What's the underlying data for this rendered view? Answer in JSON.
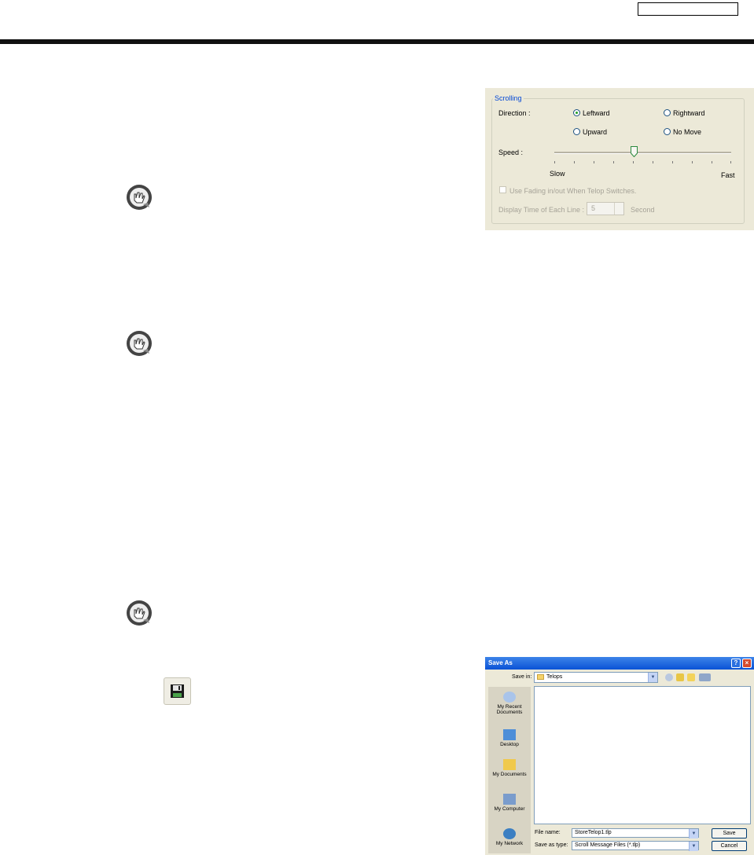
{
  "page": {
    "header_box_text": ""
  },
  "hints": [
    {
      "icon": "hint-hand-icon"
    },
    {
      "icon": "hint-hand-icon"
    },
    {
      "icon": "hint-hand-icon"
    }
  ],
  "scrolling": {
    "group_title": "Scrolling",
    "direction_label": "Direction :",
    "options": [
      {
        "label": "Leftward",
        "selected": true
      },
      {
        "label": "Rightward",
        "selected": false
      },
      {
        "label": "Upward",
        "selected": false
      },
      {
        "label": "No Move",
        "selected": false
      }
    ],
    "speed_label": "Speed :",
    "speed_level": 0.45,
    "slow_label": "Slow",
    "fast_label": "Fast",
    "fading_label": "Use Fading in/out When Telop Switches.",
    "fading_checked": false,
    "display_time_label": "Display Time of Each Line :",
    "display_time_value": "5",
    "display_time_unit": "Second"
  },
  "save_icon": {
    "icon": "floppy-disk-icon"
  },
  "save_dialog": {
    "title": "Save As",
    "help_label": "?",
    "close_label": "×",
    "save_in_label": "Save in:",
    "save_in_value": "Telops",
    "places": [
      "My Recent Documents",
      "Desktop",
      "My Documents",
      "My Computer",
      "My Network"
    ],
    "file_name_label": "File name:",
    "file_name_value": "StoreTelop1.tlp",
    "save_as_type_label": "Save as type:",
    "save_as_type_value": "Scroll Message Files (*.tlp)",
    "save_button": "Save",
    "cancel_button": "Cancel"
  },
  "colors": {
    "panel_bg": "#ece9d8",
    "title_blue": "#0a52d6",
    "group_title": "#0046d5"
  }
}
